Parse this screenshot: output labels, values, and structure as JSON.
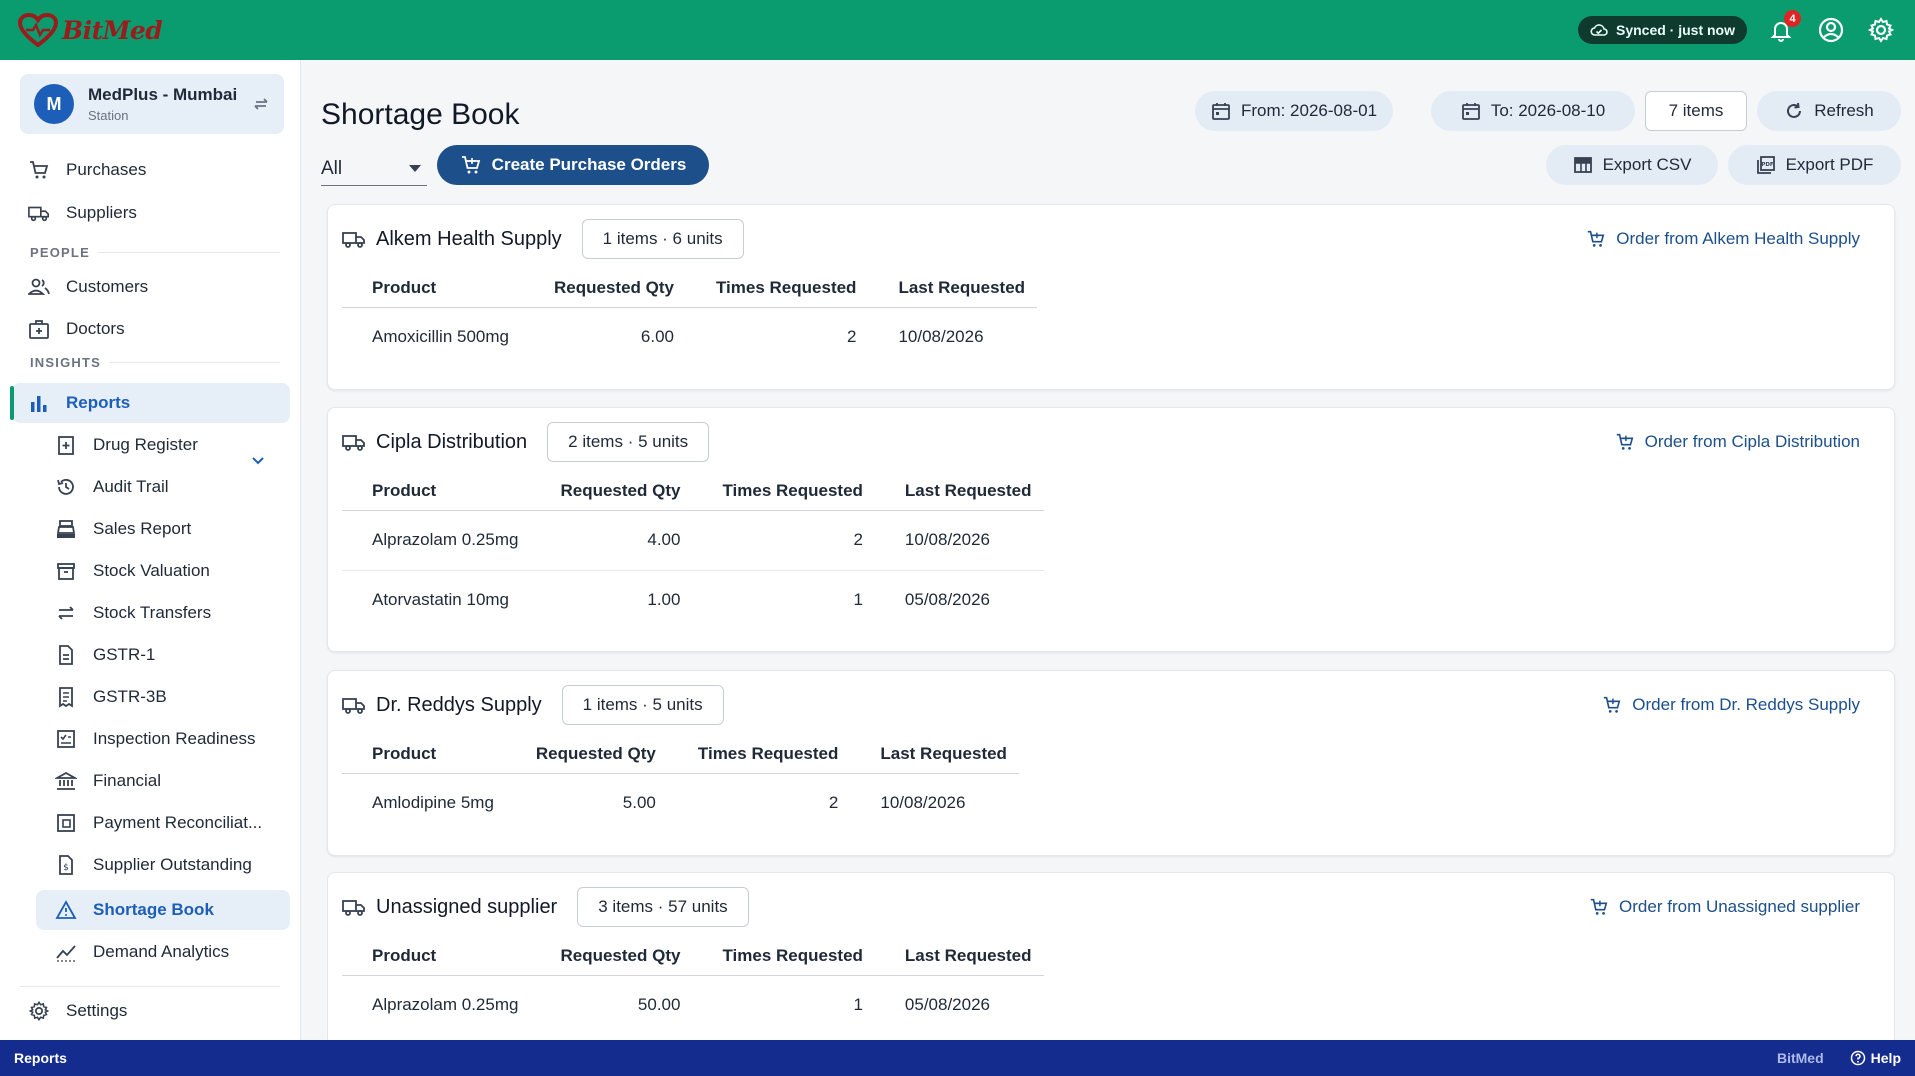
{
  "app": {
    "name": "BitMed",
    "sync_status": "Synced · just now",
    "notification_count": "4",
    "brand_color": "#0a9b6e"
  },
  "station": {
    "initial": "M",
    "name": "MedPlus - Mumbai",
    "subtitle": "Station"
  },
  "sidebar": {
    "items_top": [
      {
        "label": "Purchases",
        "icon": "cart-icon"
      },
      {
        "label": "Suppliers",
        "icon": "truck-icon"
      }
    ],
    "people_label": "PEOPLE",
    "people": [
      {
        "label": "Customers",
        "icon": "people-icon"
      },
      {
        "label": "Doctors",
        "icon": "medical-bag-icon"
      }
    ],
    "insights_label": "INSIGHTS",
    "reports_label": "Reports",
    "reports_children": [
      {
        "label": "Drug Register",
        "icon": "drug-register-icon"
      },
      {
        "label": "Audit Trail",
        "icon": "history-icon"
      },
      {
        "label": "Sales Report",
        "icon": "cash-register-icon"
      },
      {
        "label": "Stock Valuation",
        "icon": "archive-icon"
      },
      {
        "label": "Stock Transfers",
        "icon": "transfer-icon"
      },
      {
        "label": "GSTR-1",
        "icon": "document-icon"
      },
      {
        "label": "GSTR-3B",
        "icon": "receipt-icon"
      },
      {
        "label": "Inspection Readiness",
        "icon": "checklist-icon"
      },
      {
        "label": "Financial",
        "icon": "bank-icon"
      },
      {
        "label": "Payment Reconciliat...",
        "icon": "reconcile-icon"
      },
      {
        "label": "Supplier Outstanding",
        "icon": "invoice-dollar-icon"
      },
      {
        "label": "Shortage Book",
        "icon": "warning-icon"
      },
      {
        "label": "Demand Analytics",
        "icon": "trend-icon"
      }
    ],
    "settings_label": "Settings"
  },
  "page": {
    "title": "Shortage Book",
    "filter_value": "All",
    "create_po_label": "Create Purchase Orders",
    "from_label": "From: 2026-08-01",
    "to_label": "To: 2026-08-10",
    "items_count_label": "7 items",
    "refresh_label": "Refresh",
    "export_csv_label": "Export CSV",
    "export_pdf_label": "Export PDF"
  },
  "table_headers": {
    "product": "Product",
    "requested_qty": "Requested Qty",
    "times_requested": "Times Requested",
    "last_requested": "Last Requested"
  },
  "suppliers": [
    {
      "name": "Alkem Health Supply",
      "summary": "1 items · 6 units",
      "order_label": "Order from Alkem Health Supply",
      "rows": [
        {
          "product": "Amoxicillin 500mg",
          "qty": "6.00",
          "times": "2",
          "last": "10/08/2026"
        }
      ]
    },
    {
      "name": "Cipla Distribution",
      "summary": "2 items · 5 units",
      "order_label": "Order from Cipla Distribution",
      "rows": [
        {
          "product": "Alprazolam 0.25mg",
          "qty": "4.00",
          "times": "2",
          "last": "10/08/2026"
        },
        {
          "product": "Atorvastatin 10mg",
          "qty": "1.00",
          "times": "1",
          "last": "05/08/2026"
        }
      ]
    },
    {
      "name": "Dr. Reddys Supply",
      "summary": "1 items · 5 units",
      "order_label": "Order from Dr. Reddys Supply",
      "rows": [
        {
          "product": "Amlodipine 5mg",
          "qty": "5.00",
          "times": "2",
          "last": "10/08/2026"
        }
      ]
    },
    {
      "name": "Unassigned supplier",
      "summary": "3 items · 57 units",
      "order_label": "Order from Unassigned supplier",
      "rows": [
        {
          "product": "Alprazolam 0.25mg",
          "qty": "50.00",
          "times": "1",
          "last": "05/08/2026"
        }
      ]
    }
  ],
  "statusbar": {
    "left": "Reports",
    "brand": "BitMed",
    "help": "Help"
  }
}
